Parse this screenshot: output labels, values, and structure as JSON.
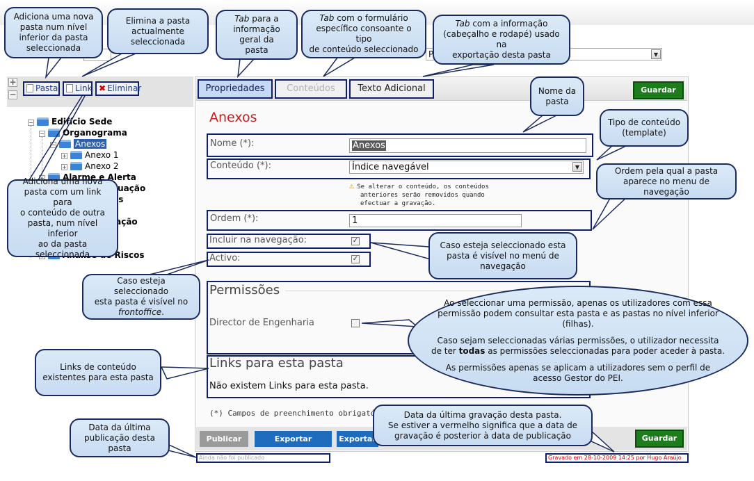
{
  "top_select_partial": "Pl",
  "top_select_left_partial": "ot",
  "left_toolbar": {
    "add_folder_label": "Pasta",
    "add_link_label": "Link",
    "delete_label": "Eliminar"
  },
  "tree": {
    "root": "Edifício Sede",
    "organograma": "Organograma",
    "anexos": "Anexos",
    "anexo1": "Anexo 1",
    "anexo2": "Anexo 2",
    "alarme": "Alarme e Alerta",
    "partial1": "cuação",
    "partial2": "os",
    "partial3": "s",
    "partial4": "lação",
    "partial5": "o",
    "analise": "Análise de Riscos"
  },
  "tabs": {
    "propriedades": "Propriedades",
    "conteudos": "Conteúdos",
    "texto_adicional": "Texto Adicional"
  },
  "buttons": {
    "guardar_top": "Guardar",
    "guardar_bottom": "Guardar",
    "publicar": "Publicar",
    "exportar_publicado": "Exportar Publicado",
    "exportar": "Exportar"
  },
  "form": {
    "heading": "Anexos",
    "nome_label": "Nome (*):",
    "nome_value": "Anexos",
    "conteudo_label": "Conteúdo (*):",
    "conteudo_value": "Índice navegável",
    "warning_line1": "Se alterar o conteúdo, os conteúdos",
    "warning_line2": "anteriores serão removidos quando",
    "warning_line3": "efectuar a gravação.",
    "ordem_label": "Ordem (*):",
    "ordem_value": "1",
    "incluir_label": "Incluir na navegação:",
    "activo_label": "Activo:",
    "incluir_checked": true,
    "activo_checked": true
  },
  "permissions": {
    "title": "Permissões",
    "item": "Director de Engenharia",
    "checked": false
  },
  "links": {
    "title": "Links para esta pasta",
    "empty": "Não existem Links para esta pasta."
  },
  "required_note": "(*) Campos de preenchimento obrigatório",
  "status": {
    "not_published": "Ainda não foi publicado",
    "saved": "Gravado em 28-10-2009 14:25 por Hugo Araújo"
  },
  "colors": {
    "accent_blue": "#1f6bbd",
    "save_green": "#1d7d1d",
    "heading_red": "#c81e1e",
    "callout_border": "#1a2a5e",
    "callout_fill": "#d3e4f5"
  },
  "callouts": {
    "c1": [
      "Adiciona uma nova",
      "pasta num nível",
      "inferior da pasta",
      "seleccionada"
    ],
    "c2": [
      "Elimina a pasta",
      "actualmente",
      "seleccionada"
    ],
    "c3_em": "Tab",
    "c3": [
      " para a",
      "informação geral da",
      "pasta"
    ],
    "c4_em": "Tab",
    "c4": [
      " com o formulário",
      "específico consoante o tipo",
      "de conteúdo seleccionado"
    ],
    "c5_em": "Tab",
    "c5": [
      " com a informação",
      "(cabeçalho e rodapé) usado na",
      "exportação desta pasta"
    ],
    "c6": [
      "Nome da",
      "pasta"
    ],
    "c7": [
      "Tipo de conteúdo",
      "(template)"
    ],
    "c8": [
      "Ordem pela qual a pasta",
      "aparece no menu de navegação"
    ],
    "c9": [
      "Adiciona uma nova",
      "pasta com um link para",
      "o conteúdo de outra",
      "pasta, num nível inferior",
      "ao da pasta",
      "seleccionada"
    ],
    "c10": [
      "Caso esteja seleccionado esta",
      "pasta é visível no menú de",
      "navegação"
    ],
    "c11": [
      "Caso esteja seleccionado",
      "esta pasta é visível no"
    ],
    "c11_em": "frontoffice",
    "c11_tail": ".",
    "c12_l1": "Ao seleccionar uma permissão, apenas os utilizadores com essa",
    "c12_l2": "permissão podem consultar esta pasta e as pastas no nível inferior",
    "c12_l3": "(filhas).",
    "c12_l4": "Caso sejam seleccionadas várias permissões, o utilizador necessita",
    "c12_l5a": "de ter ",
    "c12_l5b": "todas",
    "c12_l5c": " as permissões seleccionadas para poder aceder à pasta.",
    "c12_l6": "As permissões apenas se aplicam a utilizadores sem o perfil de",
    "c12_l7": "acesso Gestor do PEI.",
    "c13": [
      "Links de conteúdo",
      "existentes para esta pasta"
    ],
    "c14": [
      "Data da última",
      "publicação desta pasta"
    ],
    "c15": [
      "Data da última gravação desta pasta.",
      "Se estiver a vermelho significa que a data de",
      "gravação é posterior à data de publicação"
    ]
  }
}
